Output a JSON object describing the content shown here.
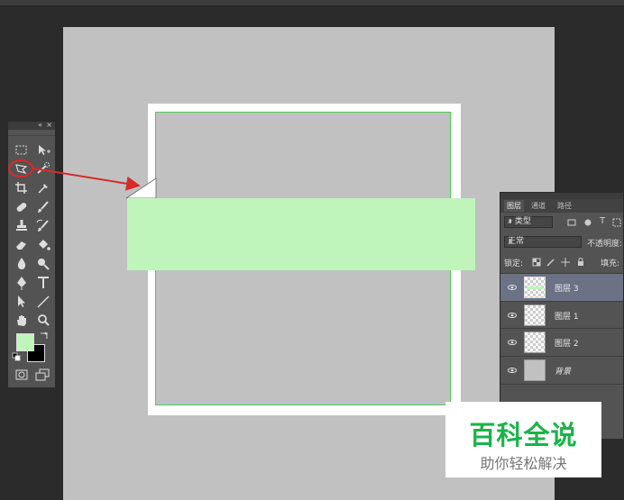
{
  "toolbox": {
    "collapse_glyph": "«",
    "close_glyph": "×",
    "tools": [
      [
        "rect-marquee-icon",
        "move-icon"
      ],
      [
        "polygonal-lasso-icon",
        "quick-select-icon"
      ],
      [
        "crop-icon",
        "eyedropper-icon"
      ],
      [
        "healing-brush-icon",
        "brush-icon"
      ],
      [
        "clone-stamp-icon",
        "history-brush-icon"
      ],
      [
        "eraser-icon",
        "paint-bucket-icon"
      ],
      [
        "blur-icon",
        "dodge-icon"
      ],
      [
        "pen-icon",
        "type-icon"
      ],
      [
        "path-select-icon",
        "line-icon"
      ],
      [
        "hand-icon",
        "zoom-icon"
      ]
    ],
    "foreground_color": "#bff5bb",
    "background_color": "#000000"
  },
  "canvas": {
    "frame_color": "#ffffff",
    "stroke_color": "#49d04f",
    "band_color": "#bff5bb",
    "canvas_color": "#c1c1c1"
  },
  "annotation": {
    "color": "#d92a2a"
  },
  "layers_panel": {
    "tabs": [
      "图层",
      "通道",
      "路径"
    ],
    "filter_label": "类型",
    "blend_mode": "正常",
    "opacity_label": "不透明度:",
    "lock_label": "锁定:",
    "fill_label": "填充:",
    "type_glyph": "T",
    "layers": [
      {
        "name": "图层 3",
        "active": true
      },
      {
        "name": "图层 1",
        "active": false
      },
      {
        "name": "图层 2",
        "active": false
      },
      {
        "name": "背景",
        "active": false,
        "italic": true
      }
    ]
  },
  "watermark": {
    "title": "百科全说",
    "subtitle": "助你轻松解决"
  }
}
